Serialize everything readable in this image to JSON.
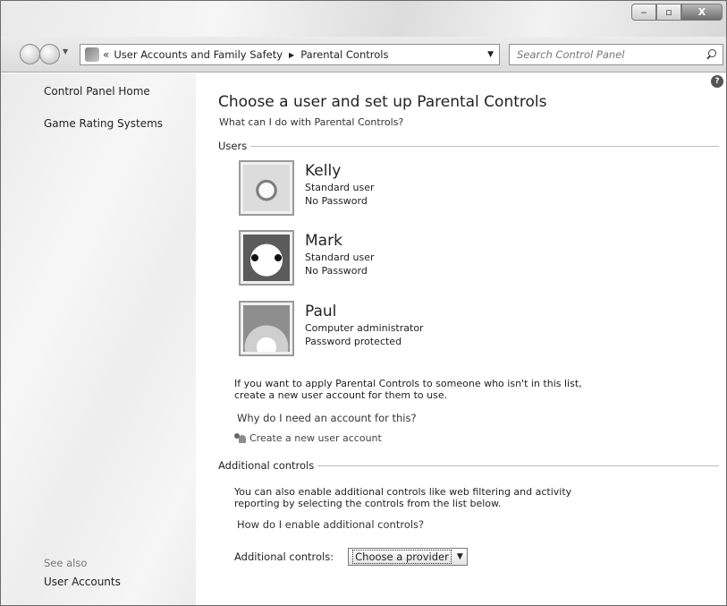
{
  "window": {
    "minimize_glyph": "‒",
    "maximize_glyph": "▫",
    "close_glyph": "X"
  },
  "address_bar": {
    "chevron": "«",
    "crumbs": [
      "User Accounts and Family Safety",
      "Parental Controls"
    ],
    "separator": "▶",
    "dropdown_glyph": "▼",
    "refresh_glyph": "↻"
  },
  "search": {
    "placeholder": "Search Control Panel"
  },
  "sidebar": {
    "links": [
      "Control Panel Home",
      "Game Rating Systems"
    ],
    "see_also_label": "See also",
    "see_also_links": [
      "User Accounts"
    ]
  },
  "main": {
    "help_glyph": "?",
    "heading": "Choose a user and set up Parental Controls",
    "sublink": "What can I do with Parental Controls?",
    "users_section_label": "Users",
    "users": [
      {
        "name": "Kelly",
        "role": "Standard user",
        "password_status": "No Password",
        "picture": "cat-picture"
      },
      {
        "name": "Mark",
        "role": "Standard user",
        "password_status": "No Password",
        "picture": "soccer-ball-picture"
      },
      {
        "name": "Paul",
        "role": "Computer administrator",
        "password_status": "Password protected",
        "picture": "flower-picture"
      }
    ],
    "note_line1": "If you want to apply Parental Controls to someone who isn't in this list,",
    "note_line2": "create a new user account for them to use.",
    "why_link": "Why do I need an account for this?",
    "create_link": "Create a new user account",
    "additional_section_label": "Additional controls",
    "additional_note_line1": "You can also enable additional controls like web filtering and activity",
    "additional_note_line2": "reporting by selecting the controls from the list below.",
    "how_link": "How do I enable additional controls?",
    "additional_controls_label": "Additional controls:",
    "provider_select_value": "Choose a provider",
    "provider_select_arrow": "▼"
  }
}
